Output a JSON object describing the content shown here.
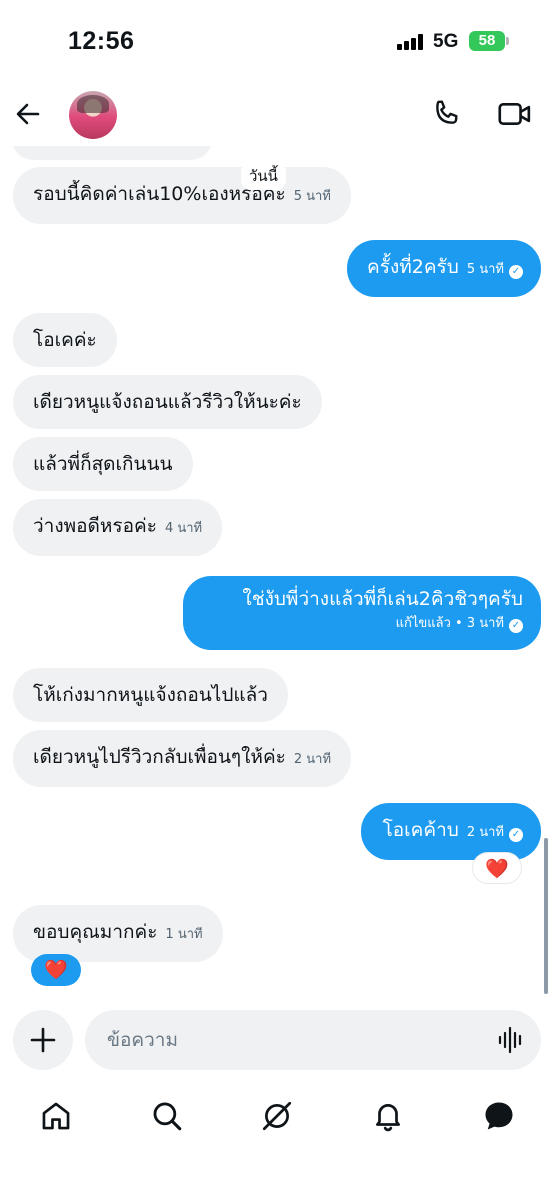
{
  "status_bar": {
    "time": "12:56",
    "network": "5G",
    "battery": "58"
  },
  "colors": {
    "accent": "#1d9bf0",
    "incoming_bubble": "#eff1f3",
    "battery": "#34c759",
    "heart": "#e0245e"
  },
  "icons": {
    "back": "arrow-left-icon",
    "call": "phone-icon",
    "video": "video-camera-icon",
    "add": "plus-icon",
    "voice": "voice-wave-icon",
    "nav": [
      "home-icon",
      "search-icon",
      "grok-icon",
      "bell-icon",
      "messages-icon"
    ]
  },
  "chat": {
    "date_separator": "วันนี้",
    "messages": [
      {
        "side": "in",
        "text": "รอบนี้คิดค่าเล่น10%เองหรอคะ",
        "time": "5 นาที"
      },
      {
        "side": "out",
        "text": "ครั้งที่2ครับ",
        "time": "5 นาที"
      },
      {
        "side": "in",
        "text": "โอเคค่ะ"
      },
      {
        "side": "in",
        "text": "เดียวหนูแจ้งถอนแล้วรีวิวให้นะค่ะ"
      },
      {
        "side": "in",
        "text": "แล้วพี่ก็สุดเกินนน"
      },
      {
        "side": "in",
        "text": "ว่างพอดีหรอค่ะ",
        "time": "4 นาที"
      },
      {
        "side": "out",
        "text": "ใช่งับพี่ว่างแล้วพี่ก็เล่น2คิวชิวๆครับ",
        "time": "แก้ไขแล้ว • 3 นาที"
      },
      {
        "side": "in",
        "text": "โห้เก่งมากหนูแจ้งถอนไปแล้ว"
      },
      {
        "side": "in",
        "text": "เดียวหนูไปรีวิวกลับเพื่อนๆให้ค่ะ",
        "time": "2 นาที"
      },
      {
        "side": "out",
        "text": "โอเคค้าบ",
        "time": "2 นาที",
        "reaction": "❤️"
      },
      {
        "side": "in",
        "text": "ขอบคุณมากค่ะ",
        "time": "1 นาที",
        "reaction": "❤️"
      }
    ]
  },
  "composer": {
    "placeholder": "ข้อความ"
  }
}
